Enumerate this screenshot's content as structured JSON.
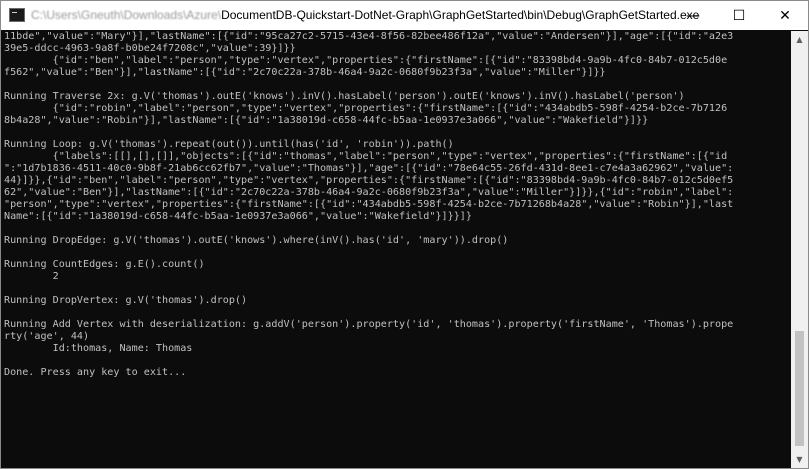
{
  "window": {
    "title_path_obscured": "C:\\Users\\Gneuth\\Downloads\\Azure\\",
    "title_path": "DocumentDB-Quickstart-DotNet-Graph\\GraphGetStarted\\bin\\Debug\\GraphGetStarted.exe",
    "minimize_glyph": "—",
    "maximize_glyph": "☐",
    "close_glyph": "✕"
  },
  "console": {
    "lines": [
      "11bde\",\"value\":\"Mary\"}],\"lastName\":[{\"id\":\"95ca27c2-5715-43e4-8f56-82bee486f12a\",\"value\":\"Andersen\"}],\"age\":[{\"id\":\"a2e3",
      "39e5-ddcc-4963-9a8f-b0be24f7208c\",\"value\":39}]}}",
      "        {\"id\":\"ben\",\"label\":\"person\",\"type\":\"vertex\",\"properties\":{\"firstName\":[{\"id\":\"83398bd4-9a9b-4fc0-84b7-012c5d0e",
      "f562\",\"value\":\"Ben\"}],\"lastName\":[{\"id\":\"2c70c22a-378b-46a4-9a2c-0680f9b23f3a\",\"value\":\"Miller\"}]}}",
      "",
      "Running Traverse 2x: g.V('thomas').outE('knows').inV().hasLabel('person').outE('knows').inV().hasLabel('person')",
      "        {\"id\":\"robin\",\"label\":\"person\",\"type\":\"vertex\",\"properties\":{\"firstName\":[{\"id\":\"434abdb5-598f-4254-b2ce-7b7126",
      "8b4a28\",\"value\":\"Robin\"}],\"lastName\":[{\"id\":\"1a38019d-c658-44fc-b5aa-1e0937e3a066\",\"value\":\"Wakefield\"}]}}",
      "",
      "Running Loop: g.V('thomas').repeat(out()).until(has('id', 'robin')).path()",
      "        {\"labels\":[[],[],[]],\"objects\":[{\"id\":\"thomas\",\"label\":\"person\",\"type\":\"vertex\",\"properties\":{\"firstName\":[{\"id",
      "\":\"1d7b1836-4511-40c0-9b8f-21ab6cc62fb7\",\"value\":\"Thomas\"}],\"age\":[{\"id\":\"78e64c55-26fd-431d-8ee1-c7e4a3a62962\",\"value\":",
      "44}]}},{\"id\":\"ben\",\"label\":\"person\",\"type\":\"vertex\",\"properties\":{\"firstName\":[{\"id\":\"83398bd4-9a9b-4fc0-84b7-012c5d0ef5",
      "62\",\"value\":\"Ben\"}],\"lastName\":[{\"id\":\"2c70c22a-378b-46a4-9a2c-0680f9b23f3a\",\"value\":\"Miller\"}]}},{\"id\":\"robin\",\"label\":",
      "\"person\",\"type\":\"vertex\",\"properties\":{\"firstName\":[{\"id\":\"434abdb5-598f-4254-b2ce-7b71268b4a28\",\"value\":\"Robin\"}],\"last",
      "Name\":[{\"id\":\"1a38019d-c658-44fc-b5aa-1e0937e3a066\",\"value\":\"Wakefield\"}]}}]}",
      "",
      "Running DropEdge: g.V('thomas').outE('knows').where(inV().has('id', 'mary')).drop()",
      "",
      "Running CountEdges: g.E().count()",
      "        2",
      "",
      "Running DropVertex: g.V('thomas').drop()",
      "",
      "Running Add Vertex with deserialization: g.addV('person').property('id', 'thomas').property('firstName', 'Thomas').prope",
      "rty('age', 44)",
      "        Id:thomas, Name: Thomas",
      "",
      "Done. Press any key to exit..."
    ]
  },
  "scrollbar": {
    "up_glyph": "▲",
    "down_glyph": "▼"
  },
  "colors": {
    "console_background": "#0c0c0c",
    "console_text": "#c0c0c0",
    "titlebar_background": "#ffffff"
  }
}
